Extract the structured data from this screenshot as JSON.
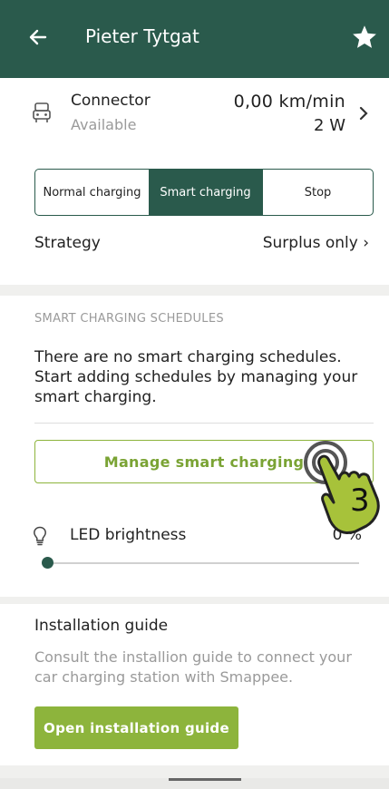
{
  "header": {
    "title": "Pieter Tytgat",
    "back_icon": "arrow-left-icon",
    "star_icon": "star-icon"
  },
  "connector": {
    "label": "Connector",
    "status": "Available",
    "speed": "0,00 km/min",
    "power": "2 W",
    "icon": "car-charger-icon"
  },
  "charging_modes": {
    "normal": "Normal charging",
    "smart": "Smart charging",
    "stop": "Stop",
    "selected": "Smart charging"
  },
  "strategy": {
    "label": "Strategy",
    "value": "Surplus only ›"
  },
  "schedules": {
    "heading": "SMART CHARGING SCHEDULES",
    "empty_text": "There are no smart charging schedules. Start adding schedules by managing your smart charging.",
    "manage_button": "Manage smart charging"
  },
  "led": {
    "label": "LED brightness",
    "value": "0 %",
    "level": 0
  },
  "installation": {
    "title": "Installation guide",
    "text": "Consult the installion guide to connect your car charging station with Smappee.",
    "button": "Open installation guide"
  },
  "overlay": {
    "step_number": "3",
    "icon": "pointing-hand-icon"
  },
  "colors": {
    "primary": "#2a5a4c",
    "accent": "#8db43c",
    "muted": "#9a9a9a"
  }
}
